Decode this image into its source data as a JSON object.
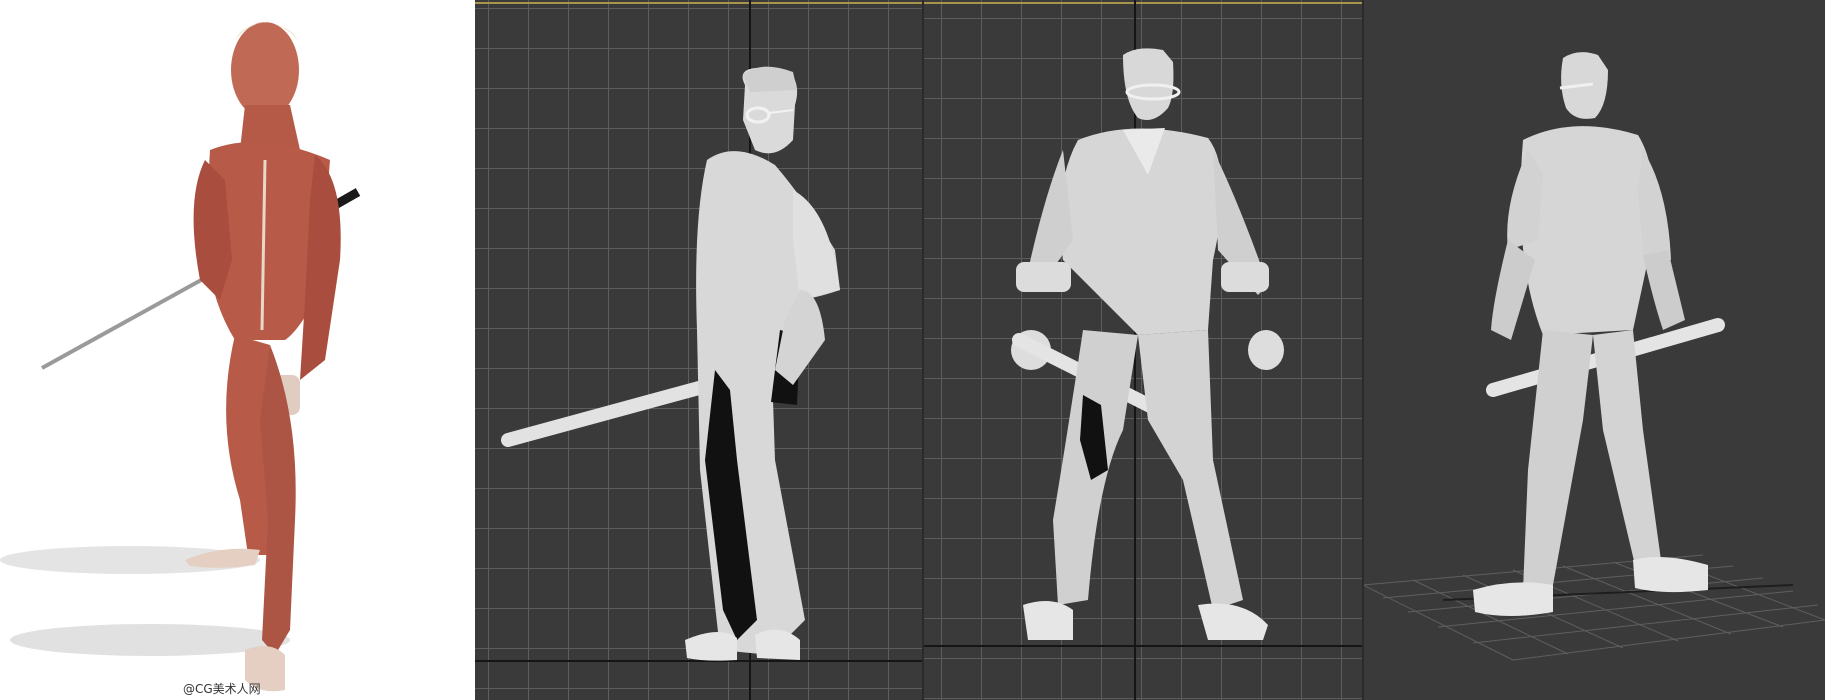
{
  "panels": {
    "anatomy": {
      "label": "anatomy-reference-render",
      "watermark": "@CG美术人网"
    },
    "front_viewport": {
      "label": "front-viewport"
    },
    "perspective_front": {
      "label": "perspective-viewport-front"
    },
    "perspective_back": {
      "label": "perspective-viewport-back"
    }
  },
  "colors": {
    "viewport_bg": "#3a3a3a",
    "grid": "#5d5d5d",
    "model": "#dcdcdc",
    "muscle": "#b85a48",
    "viewport_border": "#a89549"
  }
}
